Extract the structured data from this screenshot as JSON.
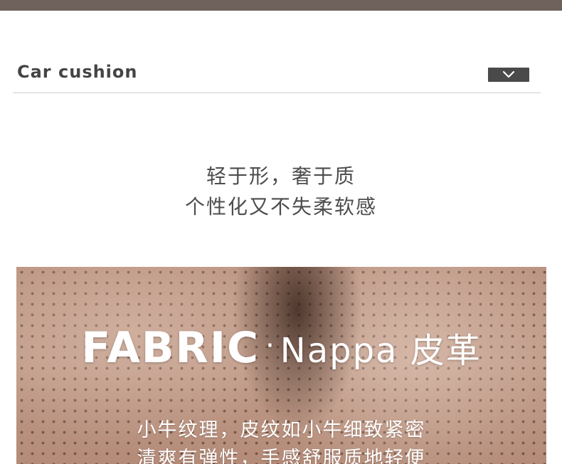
{
  "header": {
    "title": "Car cushion",
    "toggle_icon": "chevron-down-icon"
  },
  "tagline": {
    "line1": "轻于形，奢于质",
    "line2": "个性化又不失柔软感"
  },
  "fabric": {
    "title_main": "FABRIC",
    "title_separator": "·",
    "title_sub": "Nappa 皮革",
    "desc_line1": "小牛纹理，皮纹如小牛细致紧密",
    "desc_line2": "清爽有弹性，手感舒服质地轻便"
  },
  "colors": {
    "top_bar": "#6f625c",
    "header_text": "#444444",
    "toggle_bg": "#4a4a4a",
    "tagline_text": "#4d4d4d",
    "banner_base": "#b88f7c"
  }
}
